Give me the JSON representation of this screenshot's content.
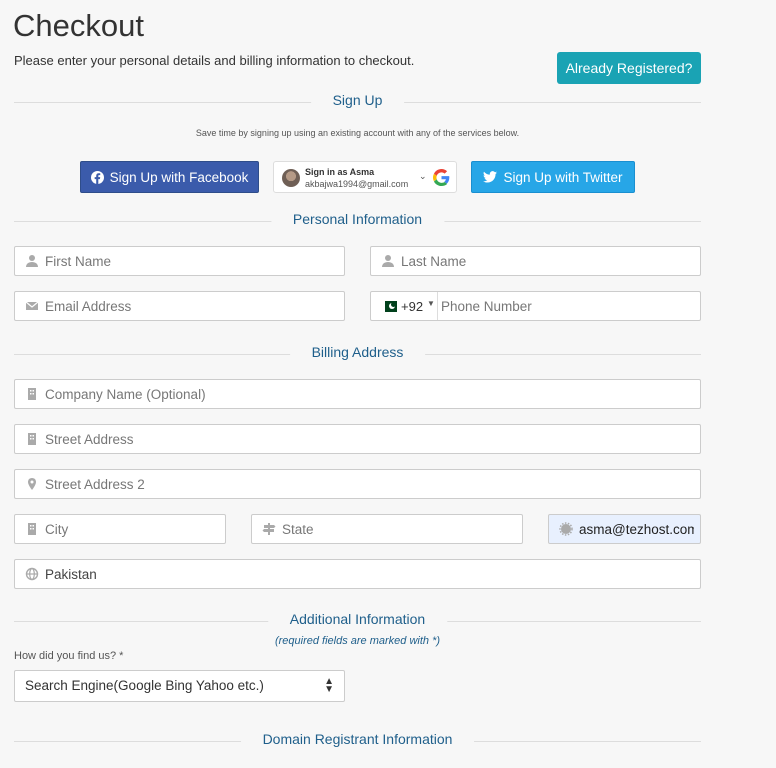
{
  "page": {
    "title": "Checkout",
    "subtitle": "Please enter your personal details and billing information to checkout.",
    "already_registered_label": "Already Registered?"
  },
  "signup": {
    "heading": "Sign Up",
    "hint": "Save time by signing up using an existing account with any of the services below.",
    "facebook_label": "Sign Up with Facebook",
    "twitter_label": "Sign Up with Twitter",
    "google_name": "Sign in as Asma",
    "google_email": "akbajwa1994@gmail.com"
  },
  "personal": {
    "heading": "Personal Information",
    "first_name_placeholder": "First Name",
    "last_name_placeholder": "Last Name",
    "email_placeholder": "Email Address",
    "phone_country_code": "+92",
    "phone_placeholder": "Phone Number"
  },
  "billing": {
    "heading": "Billing Address",
    "company_placeholder": "Company Name (Optional)",
    "street_placeholder": "Street Address",
    "street2_placeholder": "Street Address 2",
    "city_placeholder": "City",
    "state_placeholder": "State",
    "postcode_value": "asma@tezhost.com",
    "country_value": "Pakistan"
  },
  "additional": {
    "heading": "Additional Information",
    "note": "(required fields are marked with *)",
    "find_us_label": "How did you find us? *",
    "find_us_value": "Search Engine(Google Bing Yahoo etc.)"
  },
  "domain": {
    "heading": "Domain Registrant Information"
  },
  "colors": {
    "accent": "#1aa3b4",
    "section_heading": "#1f5f8b",
    "facebook": "#3b5bab",
    "twitter": "#27a6e7",
    "autofill_bg": "#e8f0fe"
  },
  "icons": [
    "user-icon",
    "envelope-icon",
    "building-icon",
    "map-marker-icon",
    "signpost-icon",
    "globe-icon",
    "facebook-icon",
    "twitter-icon",
    "google-icon"
  ]
}
